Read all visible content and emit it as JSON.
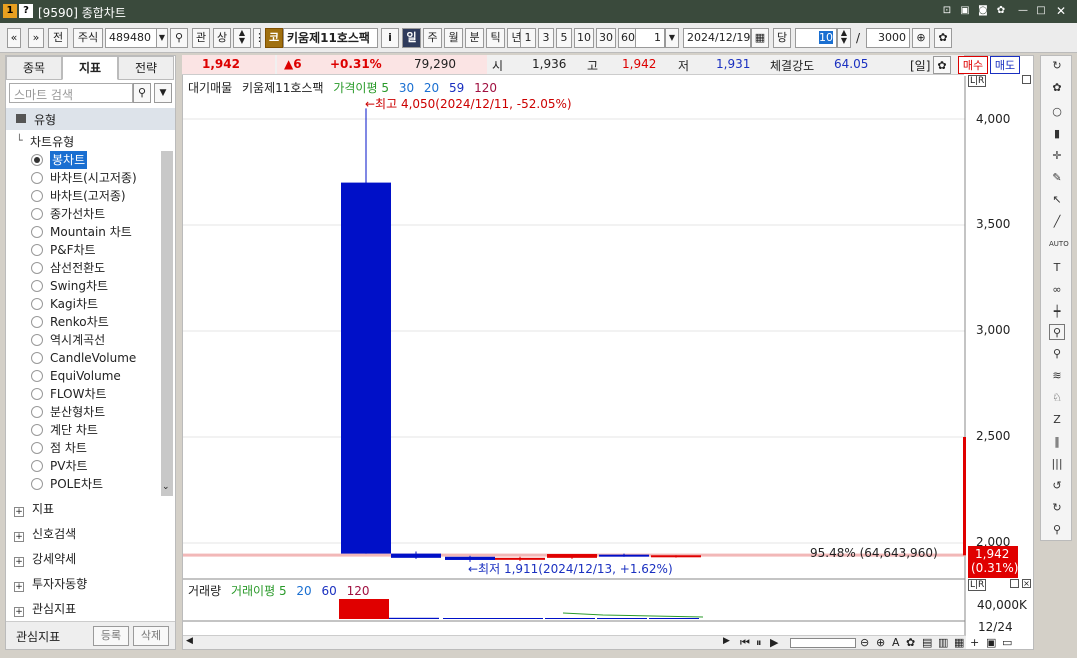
{
  "window": {
    "code_badge": "1",
    "help_badge": "?",
    "title": "[9590] 종합차트"
  },
  "toolbar": {
    "market": "주식",
    "code": "489480",
    "btn_jeon": "전",
    "btn_gwan": "관",
    "btn_sang": "상",
    "stock_badge": "코",
    "stock_name": "키움제11호스팩",
    "info_btn": "i",
    "period_tabs": [
      "일",
      "주",
      "월",
      "분",
      "틱",
      "년"
    ],
    "period_active": "일",
    "interval_buttons": [
      "1",
      "3",
      "5",
      "10",
      "30",
      "60"
    ],
    "interval_value": "1",
    "date": "2024/12/19",
    "dang": "당",
    "count": "10",
    "slash": "/",
    "total": "3000"
  },
  "left_panel": {
    "tabs": [
      "종목",
      "지표",
      "전략"
    ],
    "active_tab": "지표",
    "search_placeholder": "스마트 검색",
    "tree_root": "유형",
    "tree_child": "차트유형",
    "chart_types": [
      "봉차트",
      "바차트(시고저종)",
      "바차트(고저종)",
      "종가선차트",
      "Mountain 차트",
      "P&F차트",
      "삼선전환도",
      "Swing차트",
      "Kagi차트",
      "Renko차트",
      "역시계곡선",
      "CandleVolume",
      "EquiVolume",
      "FLOW차트",
      "분산형차트",
      "계단 차트",
      "점 차트",
      "PV차트",
      "POLE차트"
    ],
    "selected_type": "봉차트",
    "groups": [
      "지표",
      "신호검색",
      "강세약세",
      "투자자동향",
      "관심지표"
    ],
    "footer_label": "관심지표",
    "footer_register": "등록",
    "footer_delete": "삭제"
  },
  "quote": {
    "price": "1,942",
    "change": "▲6",
    "change_pct": "+0.31%",
    "volume": "79,290",
    "open_label": "시",
    "open": "1,936",
    "high_label": "고",
    "high": "1,942",
    "low_label": "저",
    "low": "1,931",
    "strength_label": "체결강도",
    "strength": "64.05",
    "period_label": "[일]",
    "buy": "매수",
    "sell": "매도"
  },
  "price_legend": {
    "item1": "대기매물",
    "item2": "키움제11호스팩",
    "item3": "가격이평",
    "ma": [
      "5",
      "30",
      "20",
      "59",
      "120"
    ]
  },
  "annotations": {
    "high": "←최고 4,050(2024/12/11, -52.05%)",
    "low": "←최저 1,911(2024/12/13, +1.62%)",
    "pct": "95.48% (64,643,960)",
    "lr": "L|R"
  },
  "price_axis": [
    "4,000",
    "3,500",
    "3,000",
    "2,500",
    "2,000"
  ],
  "current_price_label": "1,942",
  "current_pct_label": "(0.31%)",
  "volume_legend": {
    "item1": "거래량",
    "item2": "거래이평",
    "ma": [
      "5",
      "20",
      "60",
      "120"
    ]
  },
  "volume_axis": "40,000K",
  "date_axis": "12/24",
  "colors": {
    "up": "#e00000",
    "down": "#0010c8",
    "title_bg": "#3a4a3c"
  },
  "chart_data": {
    "type": "candlestick",
    "candles": [
      {
        "open": 3700,
        "high": 4050,
        "low": 1950,
        "close": 1950
      },
      {
        "open": 1950,
        "high": 1960,
        "low": 1925,
        "close": 1930
      },
      {
        "open": 1935,
        "high": 1940,
        "low": 1911,
        "close": 1920
      },
      {
        "open": 1925,
        "high": 1935,
        "low": 1915,
        "close": 1930
      },
      {
        "open": 1930,
        "high": 1945,
        "low": 1925,
        "close": 1948
      },
      {
        "open": 1945,
        "high": 1950,
        "low": 1935,
        "close": 1938
      },
      {
        "open": 1936,
        "high": 1942,
        "low": 1931,
        "close": 1942
      }
    ],
    "volumes": [
      10,
      0.6,
      0.5,
      0.5,
      0.5,
      0.5,
      0.5
    ],
    "ylim": [
      1900,
      4100
    ]
  }
}
